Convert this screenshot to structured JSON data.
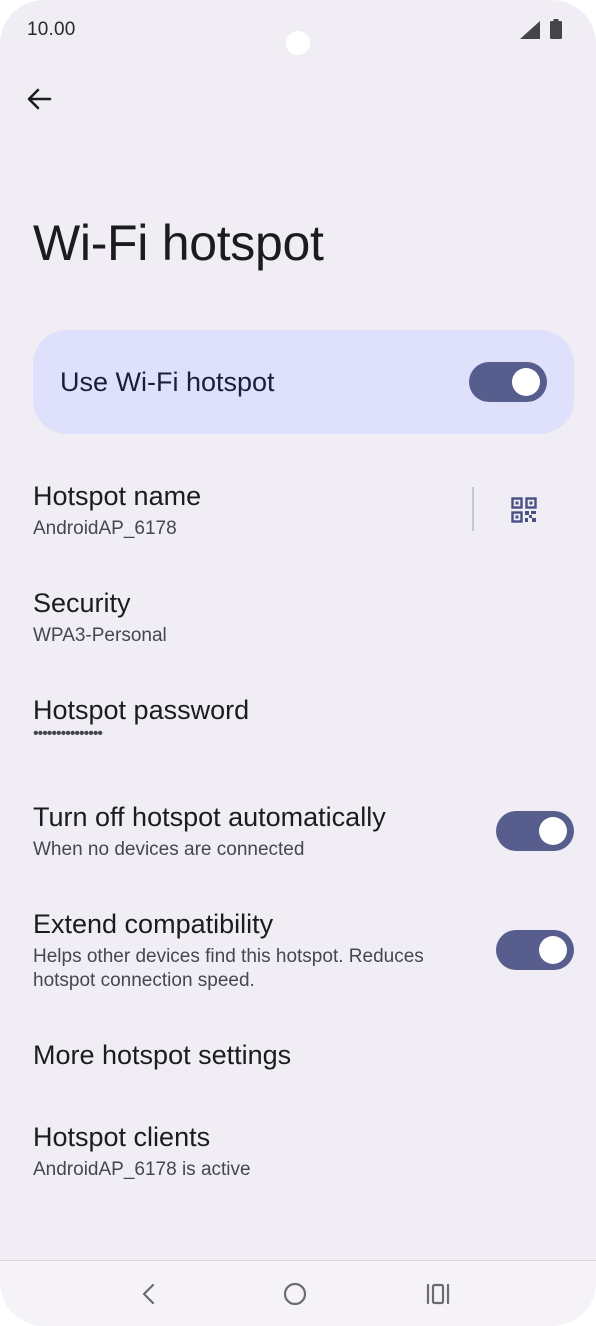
{
  "status_bar": {
    "time": "10.00",
    "icons": [
      "signal-icon",
      "battery-icon"
    ]
  },
  "header": {
    "back_icon": "arrow-left-icon",
    "title": "Wi-Fi hotspot"
  },
  "main_toggle": {
    "label": "Use Wi-Fi hotspot",
    "on": true
  },
  "settings": {
    "hotspot_name": {
      "title": "Hotspot name",
      "value": "AndroidAP_6178",
      "action_icon": "qr-code-icon"
    },
    "security": {
      "title": "Security",
      "value": "WPA3-Personal"
    },
    "password": {
      "title": "Hotspot password",
      "value": "•••••••••••••••"
    },
    "turn_off_auto": {
      "title": "Turn off hotspot automatically",
      "subtitle": "When no devices are connected",
      "on": true
    },
    "extend_compat": {
      "title": "Extend compatibility",
      "subtitle_line1": "Helps other devices find this hotspot. Reduces",
      "subtitle_line2": "hotspot connection speed.",
      "on": true
    },
    "more_settings": {
      "title": "More hotspot settings"
    },
    "clients": {
      "title": "Hotspot clients",
      "value": "AndroidAP_6178 is active"
    }
  },
  "nav_bar": {
    "icons": [
      "back-nav-icon",
      "home-nav-icon",
      "recents-nav-icon"
    ]
  },
  "colors": {
    "background": "#f1edf5",
    "toggle_card": "#dfe0fb",
    "switch_track": "#575e8d",
    "accent_icon": "#4a5086"
  }
}
